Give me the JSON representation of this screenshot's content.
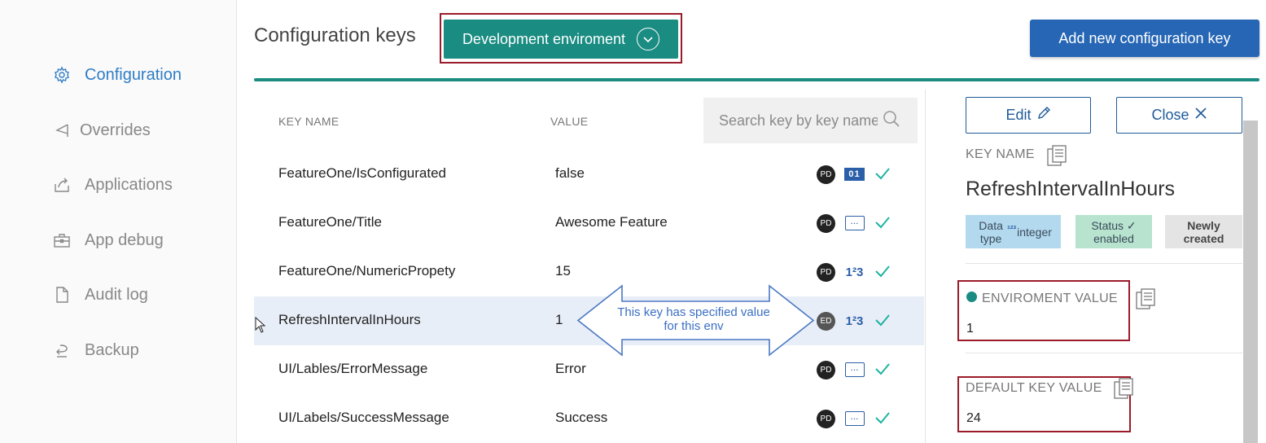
{
  "sidebar": {
    "items": [
      {
        "label": "Configuration",
        "icon": "gear-icon",
        "active": true
      },
      {
        "label": "Overrides",
        "icon": "flag-icon"
      },
      {
        "label": "Applications",
        "icon": "share-icon"
      },
      {
        "label": "App debug",
        "icon": "toolbox-icon"
      },
      {
        "label": "Audit log",
        "icon": "document-icon"
      },
      {
        "label": "Backup",
        "icon": "undo-arrow-icon"
      }
    ]
  },
  "header": {
    "title": "Configuration keys",
    "environment_label": "Development enviroment",
    "add_button_label": "Add new configuration key"
  },
  "table": {
    "columns": {
      "key_name": "KEY NAME",
      "value": "VALUE"
    },
    "search_placeholder": "Search key by key name",
    "rows": [
      {
        "key": "FeatureOne/IsConfigurated",
        "value": "false",
        "owner": "PD",
        "type": "boolean",
        "type_glyph": "01",
        "selected": false
      },
      {
        "key": "FeatureOne/Title",
        "value": "Awesome Feature",
        "owner": "PD",
        "type": "string",
        "type_glyph": "...",
        "selected": false
      },
      {
        "key": "FeatureOne/NumericPropety",
        "value": "15",
        "owner": "PD",
        "type": "number",
        "type_glyph": "1²3",
        "selected": false
      },
      {
        "key": "RefreshIntervalInHours",
        "value": "1",
        "owner": "ED",
        "type": "number",
        "type_glyph": "1²3",
        "selected": true
      },
      {
        "key": "UI/Lables/ErrorMessage",
        "value": "Error",
        "owner": "PD",
        "type": "string",
        "type_glyph": "...",
        "selected": false
      },
      {
        "key": "UI/Labels/SuccessMessage",
        "value": "Success",
        "owner": "PD",
        "type": "string",
        "type_glyph": "...",
        "selected": false
      }
    ]
  },
  "callout": {
    "text": "This key has specified value for this env"
  },
  "detail": {
    "edit_label": "Edit",
    "close_label": "Close",
    "key_name_label": "KEY NAME",
    "key_name": "RefreshIntervalInHours",
    "tags": {
      "data_type_label": "Data type",
      "data_type_glyph": "¹²³",
      "data_type_value": "integer",
      "status_label": "Status ✓",
      "status_value": "enabled",
      "state_label": "Newly created"
    },
    "env_value_label": "ENVIROMENT VALUE",
    "env_value": "1",
    "default_value_label": "DEFAULT KEY VALUE",
    "default_value": "24"
  },
  "colors": {
    "accent_teal": "#1a8c82",
    "primary_blue": "#2666b5",
    "highlight_red": "#9b1b2a",
    "active_nav": "#2f7dc7"
  }
}
